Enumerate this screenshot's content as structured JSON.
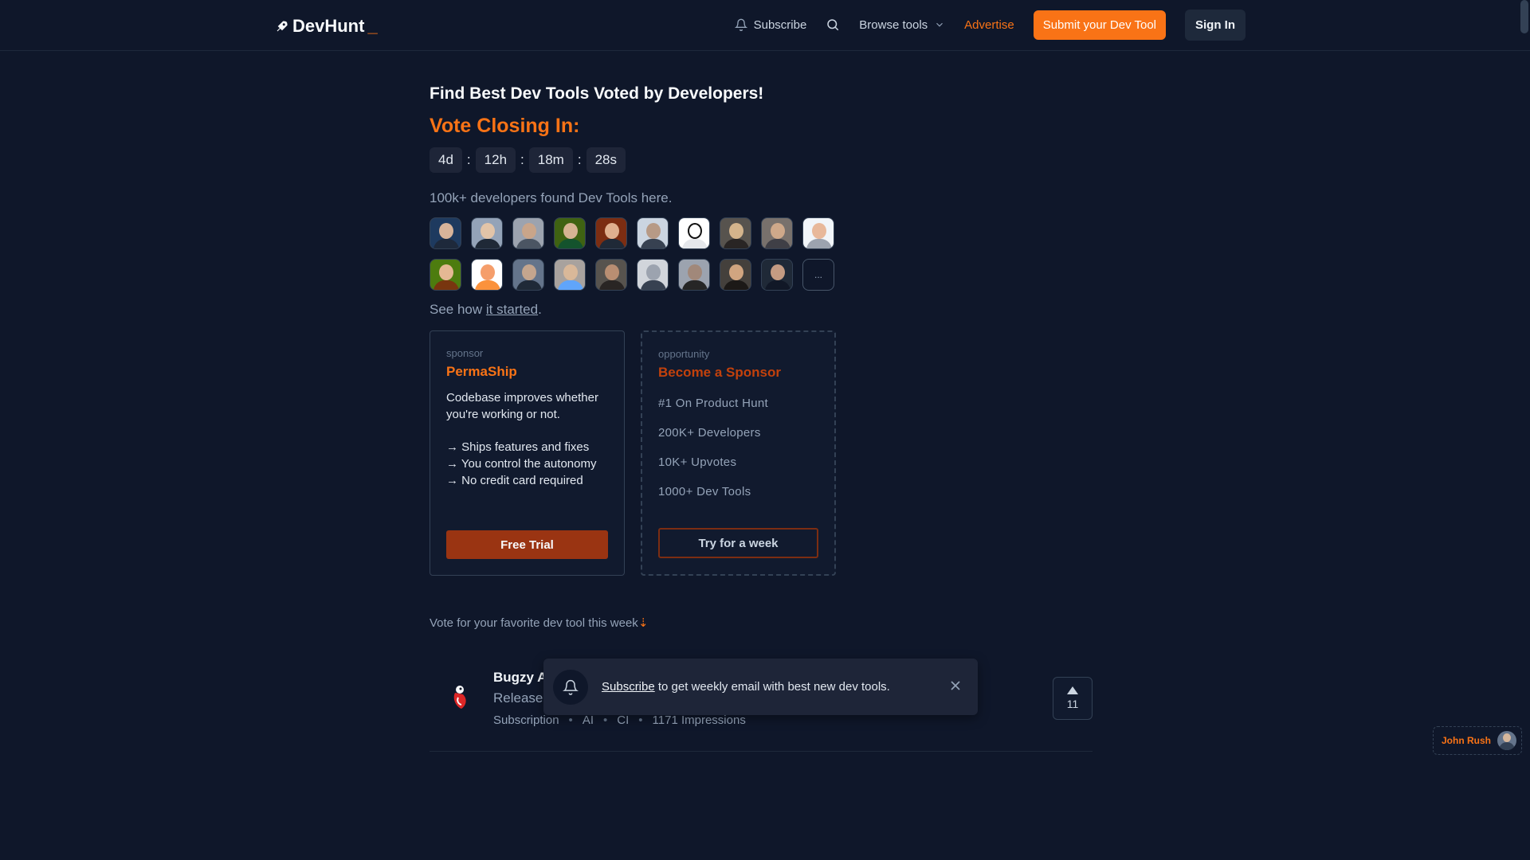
{
  "header": {
    "logo_text": "DevHunt",
    "logo_suffix": "_",
    "nav": {
      "subscribe": "Subscribe",
      "browse": "Browse tools",
      "advertise": "Advertise",
      "submit": "Submit your Dev Tool",
      "signin": "Sign In"
    }
  },
  "hero": {
    "headline": "Find Best Dev Tools Voted by Developers!",
    "vote_closing": "Vote Closing In:",
    "timer": {
      "days": "4d",
      "hours": "12h",
      "minutes": "18m",
      "seconds": "28s",
      "sep": ":"
    },
    "devs_text": "100k+ developers found Dev Tools here.",
    "avatars_more": "...",
    "see_how_prefix": "See how ",
    "see_how_link": "it started",
    "see_how_suffix": "."
  },
  "sponsor_card": {
    "kicker": "sponsor",
    "title": "PermaShip",
    "desc": "Codebase improves whether you're working or not.",
    "features": [
      "→ Ships features and fixes",
      "→ You control the autonomy",
      "→ No credit card required"
    ],
    "button": "Free Trial"
  },
  "opportunity_card": {
    "kicker": "opportunity",
    "title": "Become a Sponsor",
    "stats": [
      "#1 On Product Hunt",
      "200K+ Developers",
      "10K+ Upvotes",
      "1000+ Dev Tools"
    ],
    "button": "Try for a week"
  },
  "vote_fav": {
    "text": "Vote for your favorite dev tool this week",
    "arrow": "⇣"
  },
  "product": {
    "name": "Bugzy A",
    "subtitle": "Release",
    "tags": [
      "Subscription",
      "AI",
      "CI",
      "1171 Impressions"
    ],
    "upvotes": "11"
  },
  "toast": {
    "link": "Subscribe",
    "text": " to get weekly email with best new dev tools."
  },
  "maker": {
    "name": "John Rush"
  },
  "colors": {
    "accent": "#f97316",
    "background": "#0f172a",
    "card": "#111a2e"
  }
}
